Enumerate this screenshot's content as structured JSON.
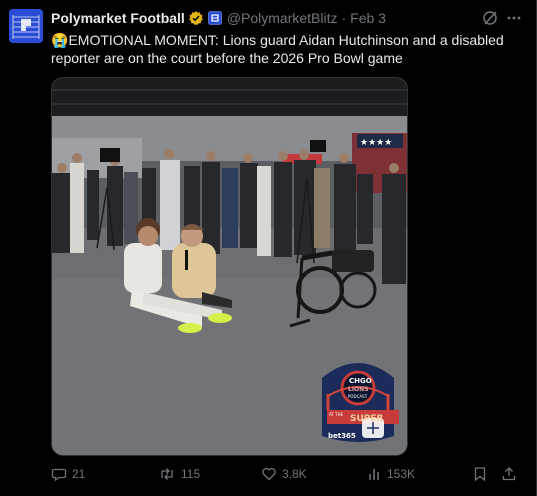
{
  "author": {
    "name": "Polymarket Football",
    "handle": "@PolymarketBlitz",
    "date": "Feb 3",
    "separator": "·",
    "verified": true,
    "avatar_color": "#2a4dd6",
    "verified_color": "#e2b719"
  },
  "tweet": {
    "emoji": "😭",
    "text": "EMOTIONAL MOMENT: Lions guard Aidan Hutchinson and a disabled reporter are on the court before the 2026 Pro Bowl game"
  },
  "media": {
    "podcast_badge": {
      "top": "CHGO",
      "top2": "LIONS",
      "sub": "PODCAST",
      "sponsor": "bet365",
      "side_text": "AT THE",
      "main_text": "SUPER"
    }
  },
  "actions": {
    "replies": "21",
    "reposts": "115",
    "likes": "3.8K",
    "views": "153K"
  },
  "icons": [
    "grok-icon",
    "more-icon",
    "reply-icon",
    "repost-icon",
    "like-icon",
    "views-icon",
    "bookmark-icon",
    "share-icon"
  ]
}
